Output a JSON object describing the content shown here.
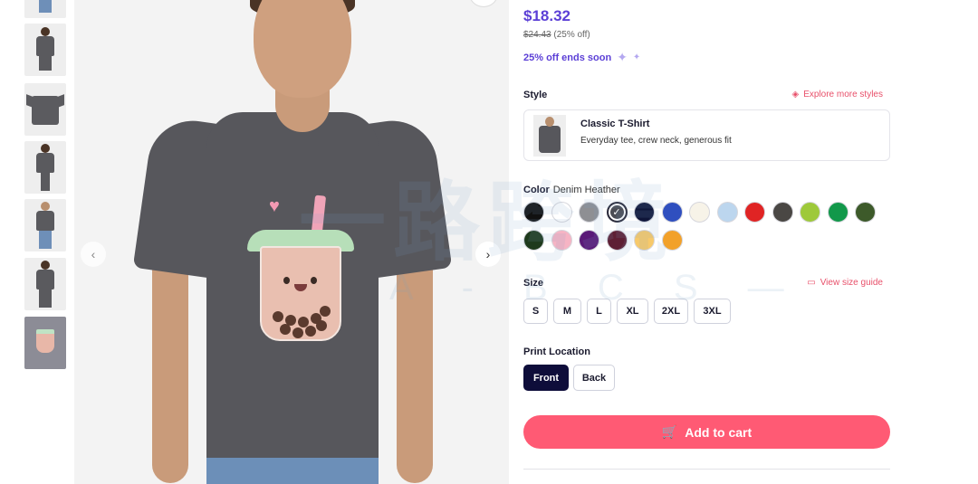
{
  "product": {
    "price": "$18.32",
    "original_price": "$24.43",
    "discount_note": "(25% off)",
    "offer_text": "25% off ends soon"
  },
  "style": {
    "label": "Style",
    "explore_link": "Explore more styles",
    "name": "Classic T-Shirt",
    "description": "Everyday tee, crew neck, generous fit"
  },
  "color": {
    "label": "Color",
    "selected": "Denim Heather",
    "swatches": [
      "#111111",
      "#ffffff",
      "#8e8f93",
      "#4a4c54",
      "#10163a",
      "#2f4fbf",
      "#f7f3e8",
      "#bcd6ee",
      "#e02424",
      "#4a4744",
      "#9ec93a",
      "#12984a",
      "#3d5a2a",
      "#1e3a1c",
      "#f6b4c4",
      "#5a1a78",
      "#5e1f34",
      "#f7c96a",
      "#f2a12a"
    ]
  },
  "size": {
    "label": "Size",
    "guide_link": "View size guide",
    "options": [
      "S",
      "M",
      "L",
      "XL",
      "2XL",
      "3XL"
    ]
  },
  "print_location": {
    "label": "Print Location",
    "options": [
      "Front",
      "Back"
    ],
    "selected": "Front"
  },
  "cart": {
    "label": "Add to cart"
  },
  "watermark": {
    "main": "一路跨境",
    "sub": "A - B C S —"
  }
}
